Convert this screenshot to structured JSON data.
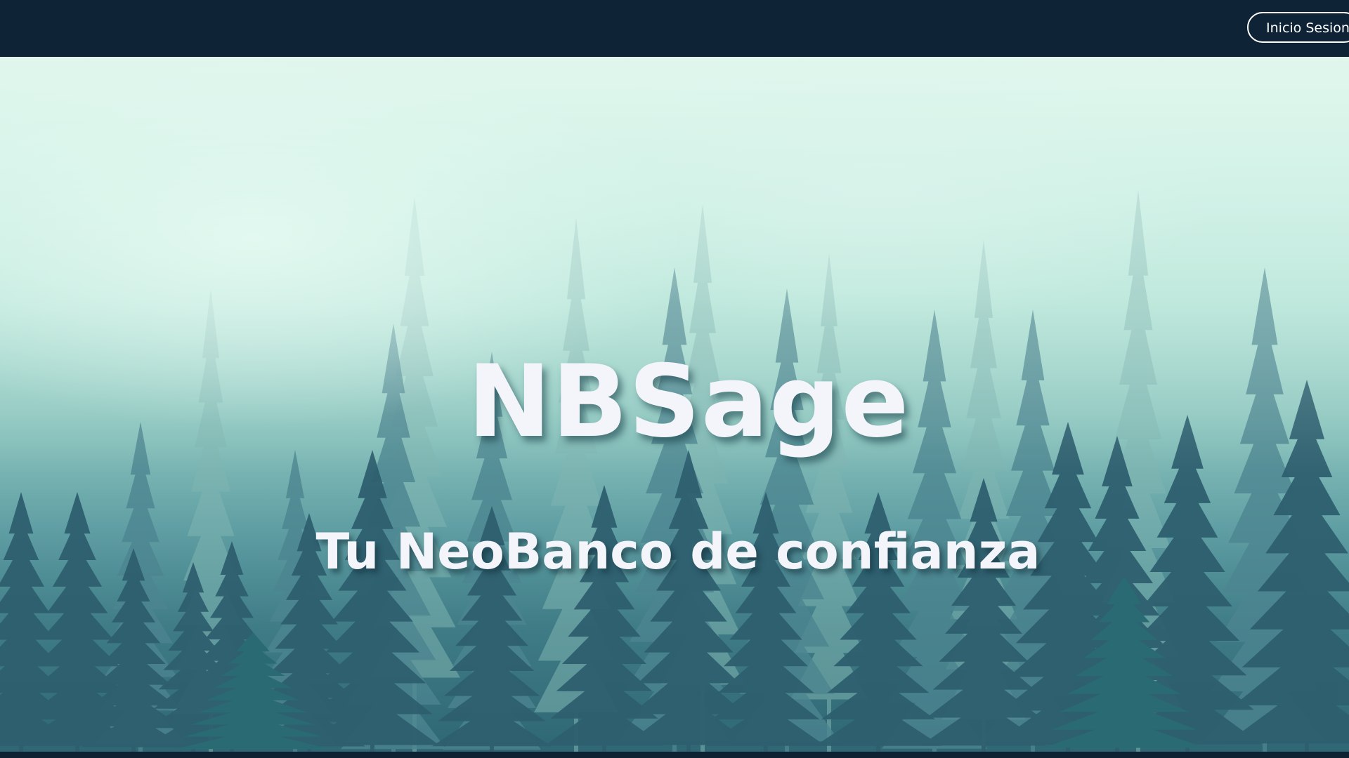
{
  "header": {
    "login_label": "Inicio Sesion"
  },
  "hero": {
    "title": "NBSage",
    "subtitle": "Tu NeoBanco de confianza",
    "background_image": "misty-pine-forest"
  },
  "colors": {
    "nav_bg": "#0f2336",
    "text": "#f4f4fb",
    "button_border": "#ffffff"
  }
}
